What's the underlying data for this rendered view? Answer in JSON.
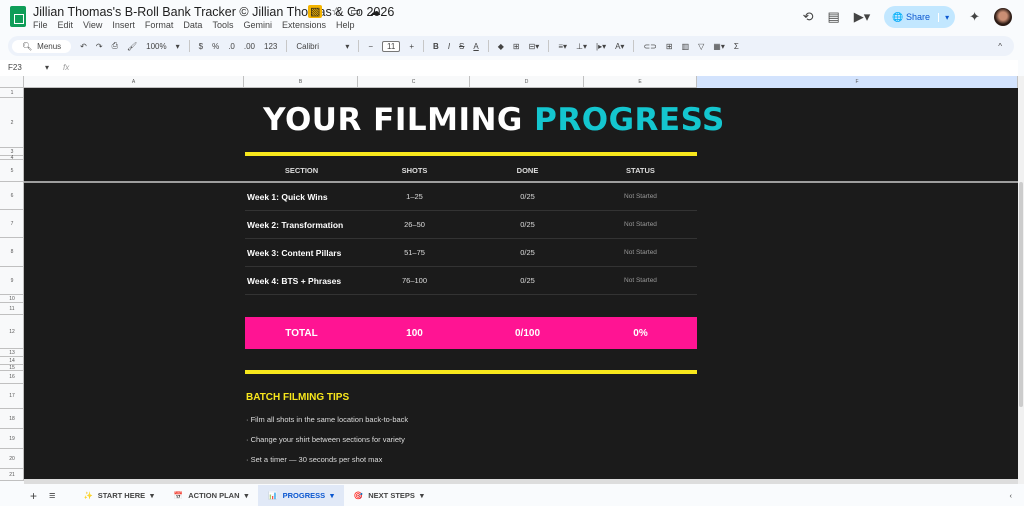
{
  "app": {
    "title": "Jillian Thomas's B-Roll Bank Tracker © Jillian Thomas & Co 2026",
    "menu": [
      "File",
      "Edit",
      "View",
      "Insert",
      "Format",
      "Data",
      "Tools",
      "Gemini",
      "Extensions",
      "Help"
    ],
    "share_label": "Share"
  },
  "toolbar": {
    "menus_label": "Menus",
    "zoom": "100%",
    "currency": "$",
    "percent": "%",
    "dec_less": ".0",
    "dec_more": ".00",
    "format_123": "123",
    "font": "Calibri",
    "font_size": "11"
  },
  "formula_bar": {
    "cell_ref": "F23",
    "fx": "fx",
    "value": ""
  },
  "columns": [
    "A",
    "B",
    "C",
    "D",
    "E",
    "F"
  ],
  "rows": [
    "1",
    "2",
    "3",
    "4",
    "5",
    "6",
    "7",
    "8",
    "9",
    "10",
    "11",
    "12",
    "13",
    "14",
    "15",
    "16",
    "17",
    "18",
    "19",
    "20",
    "21"
  ],
  "sheet": {
    "heading_part1": "YOUR FILMING ",
    "heading_part2": "PROGRESS",
    "headers": [
      "SECTION",
      "SHOTS",
      "DONE",
      "STATUS"
    ],
    "sections": [
      {
        "section": "Week 1: Quick Wins",
        "shots": "1–25",
        "done": "0/25",
        "status": "Not Started"
      },
      {
        "section": "Week 2: Transformation",
        "shots": "26–50",
        "done": "0/25",
        "status": "Not Started"
      },
      {
        "section": "Week 3: Content Pillars",
        "shots": "51–75",
        "done": "0/25",
        "status": "Not Started"
      },
      {
        "section": "Week 4: BTS + Phrases",
        "shots": "76–100",
        "done": "0/25",
        "status": "Not Started"
      }
    ],
    "total": {
      "label": "TOTAL",
      "shots": "100",
      "done": "0/100",
      "percent": "0%"
    },
    "tips_heading": "BATCH FILMING TIPS",
    "tips": [
      "Film all shots in the same location back-to-back",
      "Change your shirt between sections for variety",
      "Set a timer — 30 seconds per shot max"
    ]
  },
  "tabs": [
    {
      "label": "START HERE",
      "icon": "✨"
    },
    {
      "label": "ACTION PLAN",
      "icon": "📅"
    },
    {
      "label": "PROGRESS",
      "icon": "📊",
      "active": true
    },
    {
      "label": "NEXT STEPS",
      "icon": "🎯"
    }
  ],
  "colors": {
    "accent_cyan": "#14c6cf",
    "accent_yellow": "#f8e71c",
    "accent_pink": "#ff1493",
    "background": "#1b1b1b"
  }
}
